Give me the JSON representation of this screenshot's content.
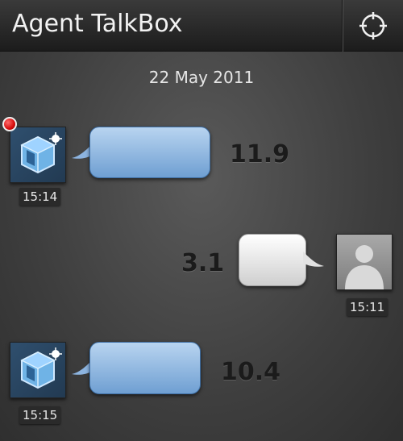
{
  "header": {
    "title": "Agent TalkBox",
    "action_icon": "crosshair-icon"
  },
  "conversation": {
    "date": "22 May 2011",
    "messages": [
      {
        "sender": "agent",
        "time": "15:14",
        "value": "11.9",
        "unread": true
      },
      {
        "sender": "user",
        "time": "15:11",
        "value": "3.1",
        "unread": false
      },
      {
        "sender": "agent",
        "time": "15:15",
        "value": "10.4",
        "unread": false
      }
    ]
  },
  "colors": {
    "agent_bubble": "#8fb6e2",
    "user_bubble": "#efefef",
    "unread": "#d60d0d"
  }
}
